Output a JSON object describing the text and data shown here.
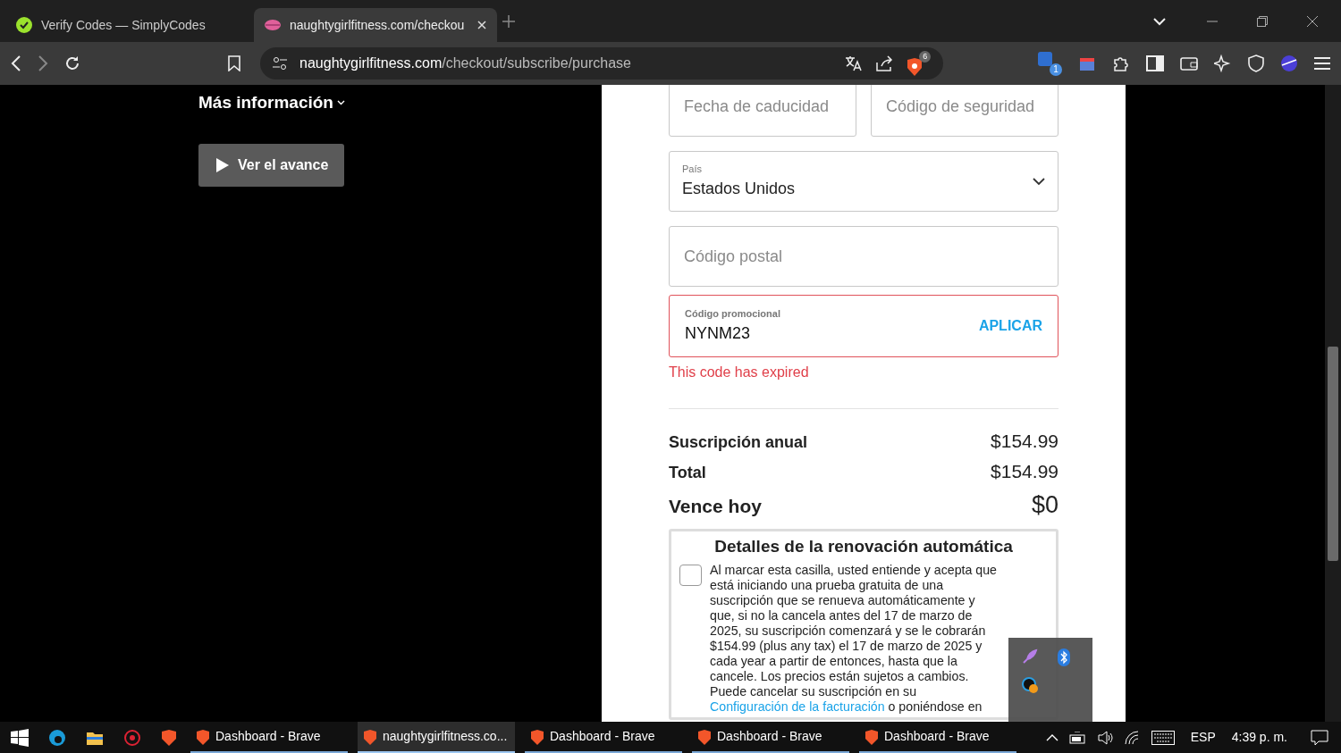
{
  "browser": {
    "tabs": [
      {
        "title": "Verify Codes — SimplyCodes",
        "selected": false
      },
      {
        "title": "naughtygirlfitness.com/checkou",
        "selected": true
      }
    ],
    "url_host": "naughtygirlfitness.com",
    "url_path": "/checkout/subscribe/purchase",
    "shield_count": "6",
    "extension_count": "1"
  },
  "page": {
    "more_info": "Más información",
    "trailer_button": "Ver el avance",
    "card_fields": [
      {
        "placeholder": "Fecha de caducidad"
      },
      {
        "placeholder": "Código de seguridad"
      }
    ],
    "country": {
      "label": "País",
      "value": "Estados Unidos"
    },
    "postal": {
      "placeholder": "Código postal"
    },
    "promo": {
      "label": "Código promocional",
      "value": "NYNM23",
      "action": "APLICAR",
      "invalid": true,
      "error": "This code has expired"
    },
    "summary": [
      {
        "kind": "line",
        "label": "Suscripción anual",
        "amount": "$154.99"
      },
      {
        "kind": "line",
        "label": "Total",
        "amount": "$154.99"
      },
      {
        "kind": "due",
        "label": "Vence hoy",
        "amount": "$0"
      }
    ],
    "renewal": {
      "title": "Detalles de la renovación automática",
      "checked": false,
      "text": "Al marcar esta casilla, usted entiende y acepta que está iniciando una prueba gratuita de una suscripción que se renueva automáticamente y que, si no la cancela antes del 17 de marzo de 2025, su suscripción comenzará y se le cobrarán $154.99 (plus any tax) el 17 de marzo de 2025 y cada year a partir de entonces, hasta que la cancele. Los precios están sujetos a cambios. Puede cancelar su suscripción en su",
      "link": "Configuración de la facturación",
      "text_after": "o poniéndose en"
    }
  },
  "taskbar": {
    "windows": [
      {
        "title": "Dashboard - Brave",
        "selected": false
      },
      {
        "title": "naughtygirlfitness.co...",
        "selected": true
      },
      {
        "title": "Dashboard - Brave",
        "selected": false
      },
      {
        "title": "Dashboard - Brave",
        "selected": false
      },
      {
        "title": "Dashboard - Brave",
        "selected": false
      }
    ],
    "language": "ESP",
    "time": "4:39 p. m."
  }
}
